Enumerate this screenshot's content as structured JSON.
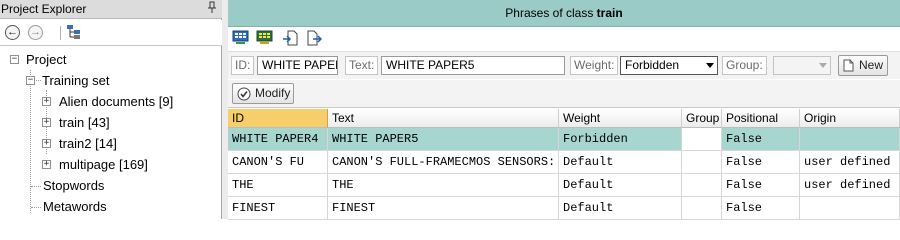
{
  "project_explorer": {
    "title": "Project Explorer",
    "pin_icon": "pin-icon",
    "toolbar": {
      "back_icon": "back-arrow-icon",
      "forward_icon": "forward-arrow-icon",
      "tree_icon": "tree-structure-icon"
    },
    "tree": {
      "root": {
        "label": "Project"
      },
      "training_set": {
        "label": "Training set"
      },
      "classes": [
        {
          "label": "Alien documents [9]"
        },
        {
          "label": "train [43]"
        },
        {
          "label": "train2 [14]"
        },
        {
          "label": "multipage [169]"
        }
      ],
      "stopwords": {
        "label": "Stopwords"
      },
      "metawords": {
        "label": "Metawords"
      }
    }
  },
  "header": {
    "prefix": "Phrases of class ",
    "class_name": "train"
  },
  "toolbar_icons": [
    "grid-view-icon",
    "grid-view-alt-icon",
    "import-icon",
    "export-icon"
  ],
  "form": {
    "id_label": "ID:",
    "id_value": "WHITE PAPER",
    "text_label": "Text:",
    "text_value": "WHITE PAPER5",
    "weight_label": "Weight:",
    "weight_value": "Forbidden",
    "group_label": "Group:",
    "group_value": "",
    "new_button": "New",
    "modify_button": "Modify"
  },
  "table": {
    "columns": [
      "ID",
      "Text",
      "Weight",
      "Group",
      "Positional",
      "Origin"
    ],
    "rows": [
      {
        "id": "WHITE PAPER4",
        "text": "WHITE PAPER5",
        "weight": "Forbidden",
        "group": "",
        "positional": "False",
        "origin": ""
      },
      {
        "id": "CANON'S FU",
        "text": "CANON'S FULL-FRAMECMOS SENSORS:",
        "weight": "Default",
        "group": "",
        "positional": "False",
        "origin": "user defined"
      },
      {
        "id": "THE",
        "text": "THE",
        "weight": "Default",
        "group": "",
        "positional": "False",
        "origin": "user defined"
      },
      {
        "id": "FINEST",
        "text": "FINEST",
        "weight": "Default",
        "group": "",
        "positional": "False",
        "origin": ""
      }
    ]
  },
  "colors": {
    "header_band": "#9bcbc6",
    "selected_row": "#a7d5cf",
    "active_column_header": "#f6cf6a"
  }
}
